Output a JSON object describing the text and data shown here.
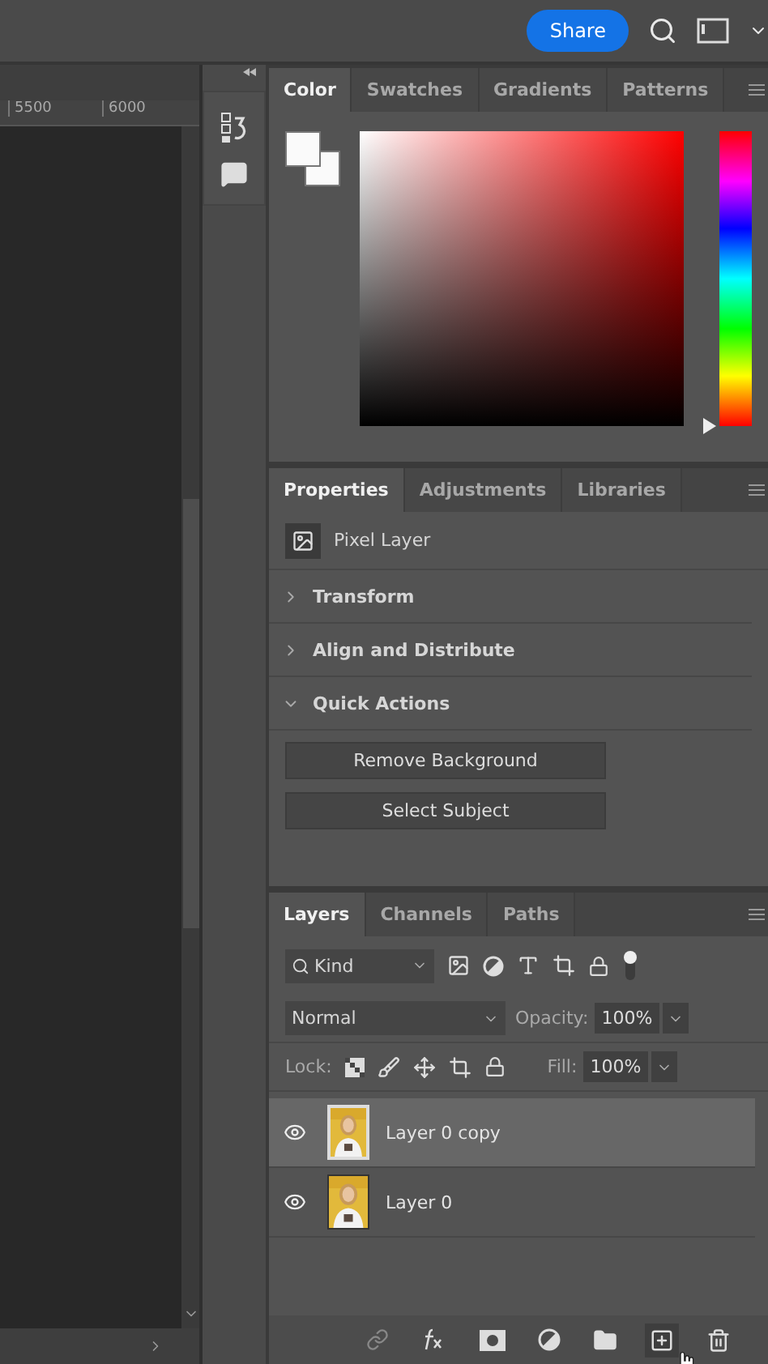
{
  "top_bar": {
    "share_button": "Share"
  },
  "ruler": {
    "ticks": [
      "5500",
      "6000"
    ]
  },
  "color_panel": {
    "tabs": [
      {
        "label": "Color",
        "selected": true
      },
      {
        "label": "Swatches",
        "selected": false
      },
      {
        "label": "Gradients",
        "selected": false
      },
      {
        "label": "Patterns",
        "selected": false
      }
    ],
    "hue_slider": {
      "level": 0
    }
  },
  "properties_panel": {
    "tabs": [
      {
        "label": "Properties",
        "selected": true
      },
      {
        "label": "Adjustments",
        "selected": false
      },
      {
        "label": "Libraries",
        "selected": false
      }
    ],
    "layer_type": "Pixel Layer",
    "sections": [
      {
        "title": "Transform",
        "expanded": false
      },
      {
        "title": "Align and Distribute",
        "expanded": false
      },
      {
        "title": "Quick Actions",
        "expanded": true
      }
    ],
    "quick_actions": [
      "Remove Background",
      "Select Subject"
    ]
  },
  "layers_panel": {
    "tabs": [
      {
        "label": "Layers",
        "selected": true
      },
      {
        "label": "Channels",
        "selected": false
      },
      {
        "label": "Paths",
        "selected": false
      }
    ],
    "filter": "Kind",
    "blend_mode": "Normal",
    "opacity_label": "Opacity:",
    "opacity": "100%",
    "lock_label": "Lock:",
    "fill_label": "Fill:",
    "fill": "100%",
    "layers": [
      {
        "name": "Layer 0 copy",
        "selected": true,
        "visible": true
      },
      {
        "name": "Layer 0",
        "selected": false,
        "visible": true
      }
    ]
  }
}
